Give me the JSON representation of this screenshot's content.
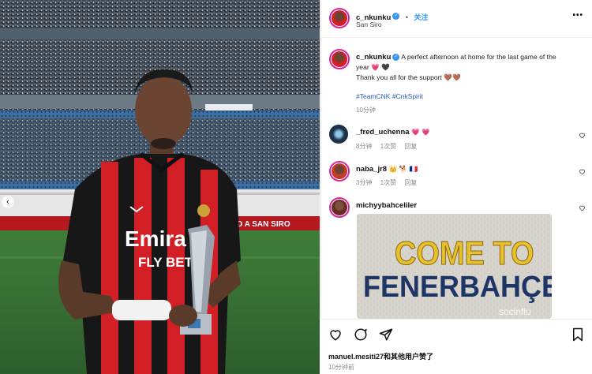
{
  "header": {
    "username": "c_nkunku",
    "follow_label": "关注",
    "location": "San Siro",
    "more_label": "•••"
  },
  "caption": {
    "username": "c_nkunku",
    "text_line1": "A perfect afternoon at home for the last game of the",
    "text_line2": "year",
    "emoji_line1": "💗 🖤",
    "thanks": "Thank you all for the support",
    "thanks_emoji": "🤎🤎",
    "hashtags": "#TeamCNK #CnkSpirit",
    "time": "10分钟"
  },
  "comments": [
    {
      "username": "_fred_uchenna",
      "text": "💗 💗",
      "time": "8分钟",
      "likes": "1次赞",
      "reply": "回复"
    },
    {
      "username": "naba_jr8",
      "text": "👑 🐕 🇫🇷",
      "time": "3分钟",
      "likes": "1次赞",
      "reply": "回复"
    },
    {
      "username": "michyybahceliler",
      "text": "",
      "time": "",
      "likes": "",
      "reply": ""
    }
  ],
  "fener_image": {
    "line1": "COME TO",
    "line2": "FENERBAHÇE",
    "watermark": "socinflu"
  },
  "photo": {
    "jersey_line1": "Emira",
    "jersey_line2": "FLY BET",
    "banner_text": "D A SAN SIRO"
  },
  "footer": {
    "likes_text": "manuel.mesiti27和其他用户赞了",
    "time": "10分钟前"
  },
  "colors": {
    "accent_blue": "#3897f0",
    "milan_red": "#d21f26",
    "fener_yellow": "#e8c12c",
    "fener_navy": "#1f3566"
  }
}
